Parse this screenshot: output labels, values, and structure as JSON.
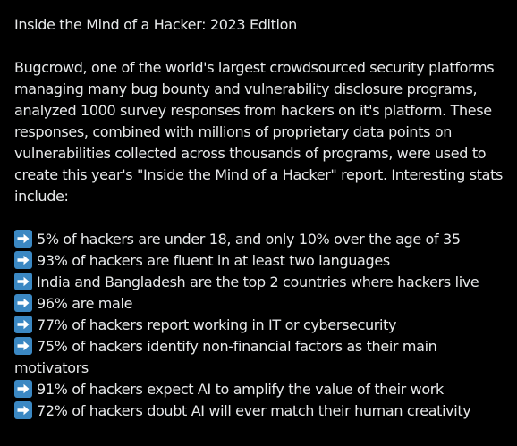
{
  "post": {
    "title": "Inside the Mind of a Hacker: 2023 Edition",
    "paragraph": "Bugcrowd, one of the world's largest crowdsourced security platforms managing many bug bounty and vulnerability disclosure programs, analyzed 1000 survey responses from hackers on it's platform. These responses, combined with millions of proprietary data points on vulnerabilities collected across thousands of programs, were used to create this year's \"Inside the Mind of a Hacker\" report. Interesting stats include:",
    "stats_icon": "right-arrow-emoji",
    "stats": [
      "5% of hackers are under 18, and only 10% over the age of 35",
      "93% of hackers are fluent in at least two languages",
      "India and Bangladesh are the top 2 countries where hackers live",
      "96% are male",
      "77% of hackers report working in IT or cybersecurity",
      "75% of hackers identify non-financial factors as their main motivators",
      "91% of hackers expect AI to amplify the value of their work",
      "72% of hackers doubt AI will ever match their human creativity"
    ]
  },
  "colors": {
    "background": "#000000",
    "text": "#e7e9ea",
    "arrow_emoji_bg": "#3b88c3"
  }
}
